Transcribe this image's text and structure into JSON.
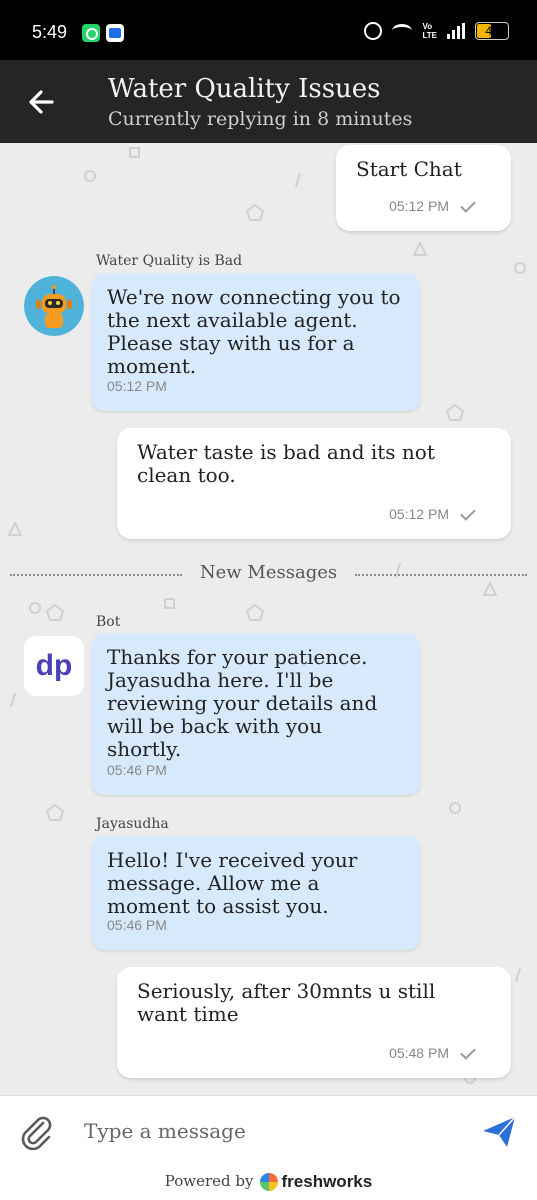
{
  "status_bar": {
    "time": "5:49",
    "volte": "Vo\nLTE",
    "battery": "45",
    "battery_level": 0.45
  },
  "header": {
    "title": "Water Quality Issues",
    "subtitle": "Currently replying in 8 minutes"
  },
  "messages": [
    {
      "role": "user",
      "text": "Start Chat",
      "time": "05:12 PM"
    },
    {
      "role": "bot",
      "sender": "Water Quality is Bad",
      "text": "We're now connecting you to the next available agent. Please stay with us for a moment.",
      "time": "05:12 PM",
      "avatar": "robot-avatar"
    },
    {
      "role": "user",
      "text": "Water taste is bad and its not clean too.",
      "time": "05:12 PM"
    },
    {
      "role": "bot",
      "sender": "Bot",
      "text": "Thanks for your patience. Jayasudha here. I'll be reviewing your details and will be back with you shortly.",
      "time": "05:46 PM",
      "avatar": "dp-logo"
    },
    {
      "role": "bot",
      "sender": "Jayasudha",
      "text": "Hello! I've received your message. Allow me a moment to assist you.",
      "time": "05:46 PM"
    },
    {
      "role": "user",
      "text": "Seriously, after 30mnts u still want time",
      "time": "05:48 PM"
    }
  ],
  "divider": "New Messages",
  "avatar_dp_text": "dp",
  "input": {
    "placeholder": "Type a message",
    "value": ""
  },
  "footer": {
    "powered_by": "Powered by",
    "brand": "freshworks"
  },
  "colors": {
    "bot_bubble": "#d7eafc",
    "user_bubble": "#ffffff",
    "header": "#252525",
    "send": "#2c6fd6"
  }
}
